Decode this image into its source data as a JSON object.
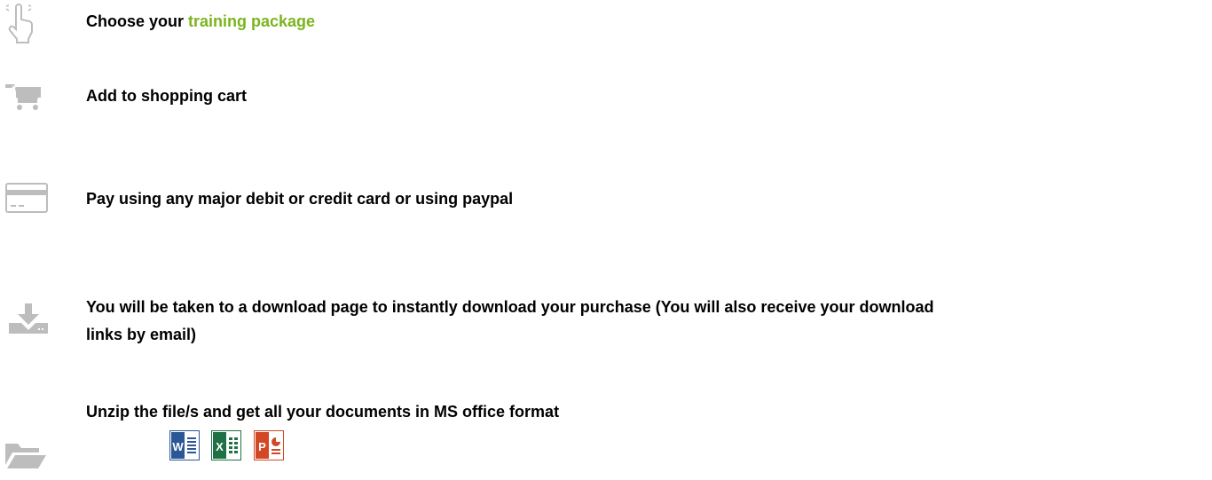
{
  "steps": [
    {
      "icon": "hand-pointer-icon",
      "text_prefix": "Choose your ",
      "link_text": "training package"
    },
    {
      "icon": "shopping-cart-icon",
      "text": "Add to shopping cart"
    },
    {
      "icon": "credit-card-icon",
      "text": "Pay using any major debit or credit card or using paypal"
    },
    {
      "icon": "download-icon",
      "line1": "You will be taken to a download page to instantly download your purchase (You will also receive your download",
      "line2": "links by email)"
    },
    {
      "icon": "folder-open-icon",
      "text": "Unzip the file/s and get all your documents in MS office format"
    }
  ],
  "office_formats": [
    {
      "name": "word-icon",
      "letter": "W",
      "color": "#2b5797"
    },
    {
      "name": "excel-icon",
      "letter": "X",
      "color": "#1e7145"
    },
    {
      "name": "powerpoint-icon",
      "letter": "P",
      "color": "#d24726"
    }
  ],
  "colors": {
    "accent": "#7ab51d",
    "icon_gray": "#bdbdbd",
    "text": "#000000"
  }
}
